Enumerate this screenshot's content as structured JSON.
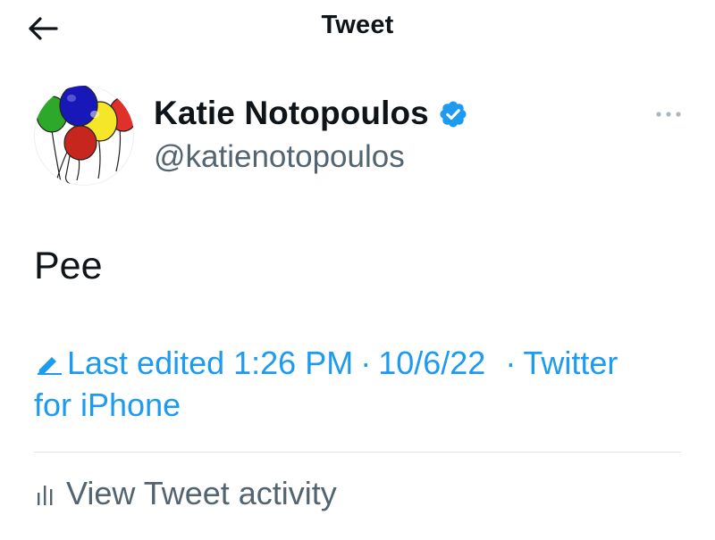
{
  "header": {
    "title": "Tweet",
    "back_icon": "arrow-left-icon"
  },
  "author": {
    "display_name": "Katie Notopoulos",
    "handle": "@katienotopoulos",
    "verified": true,
    "avatar_icon": "balloons-avatar",
    "more_icon": "more-dots-icon"
  },
  "tweet": {
    "text": "Pee"
  },
  "meta": {
    "edit_icon": "pencil-icon",
    "last_edited_label": "Last edited 1:26 PM",
    "date": "10/6/22",
    "source_line1": "Twitter",
    "source_line2": "for iPhone",
    "separator": "·"
  },
  "activity": {
    "icon": "bar-chart-icon",
    "label": "View Tweet activity"
  },
  "colors": {
    "accent": "#1d9bf0",
    "text": "#0f1419",
    "secondary": "#536471",
    "divider": "#dfe3e6"
  }
}
